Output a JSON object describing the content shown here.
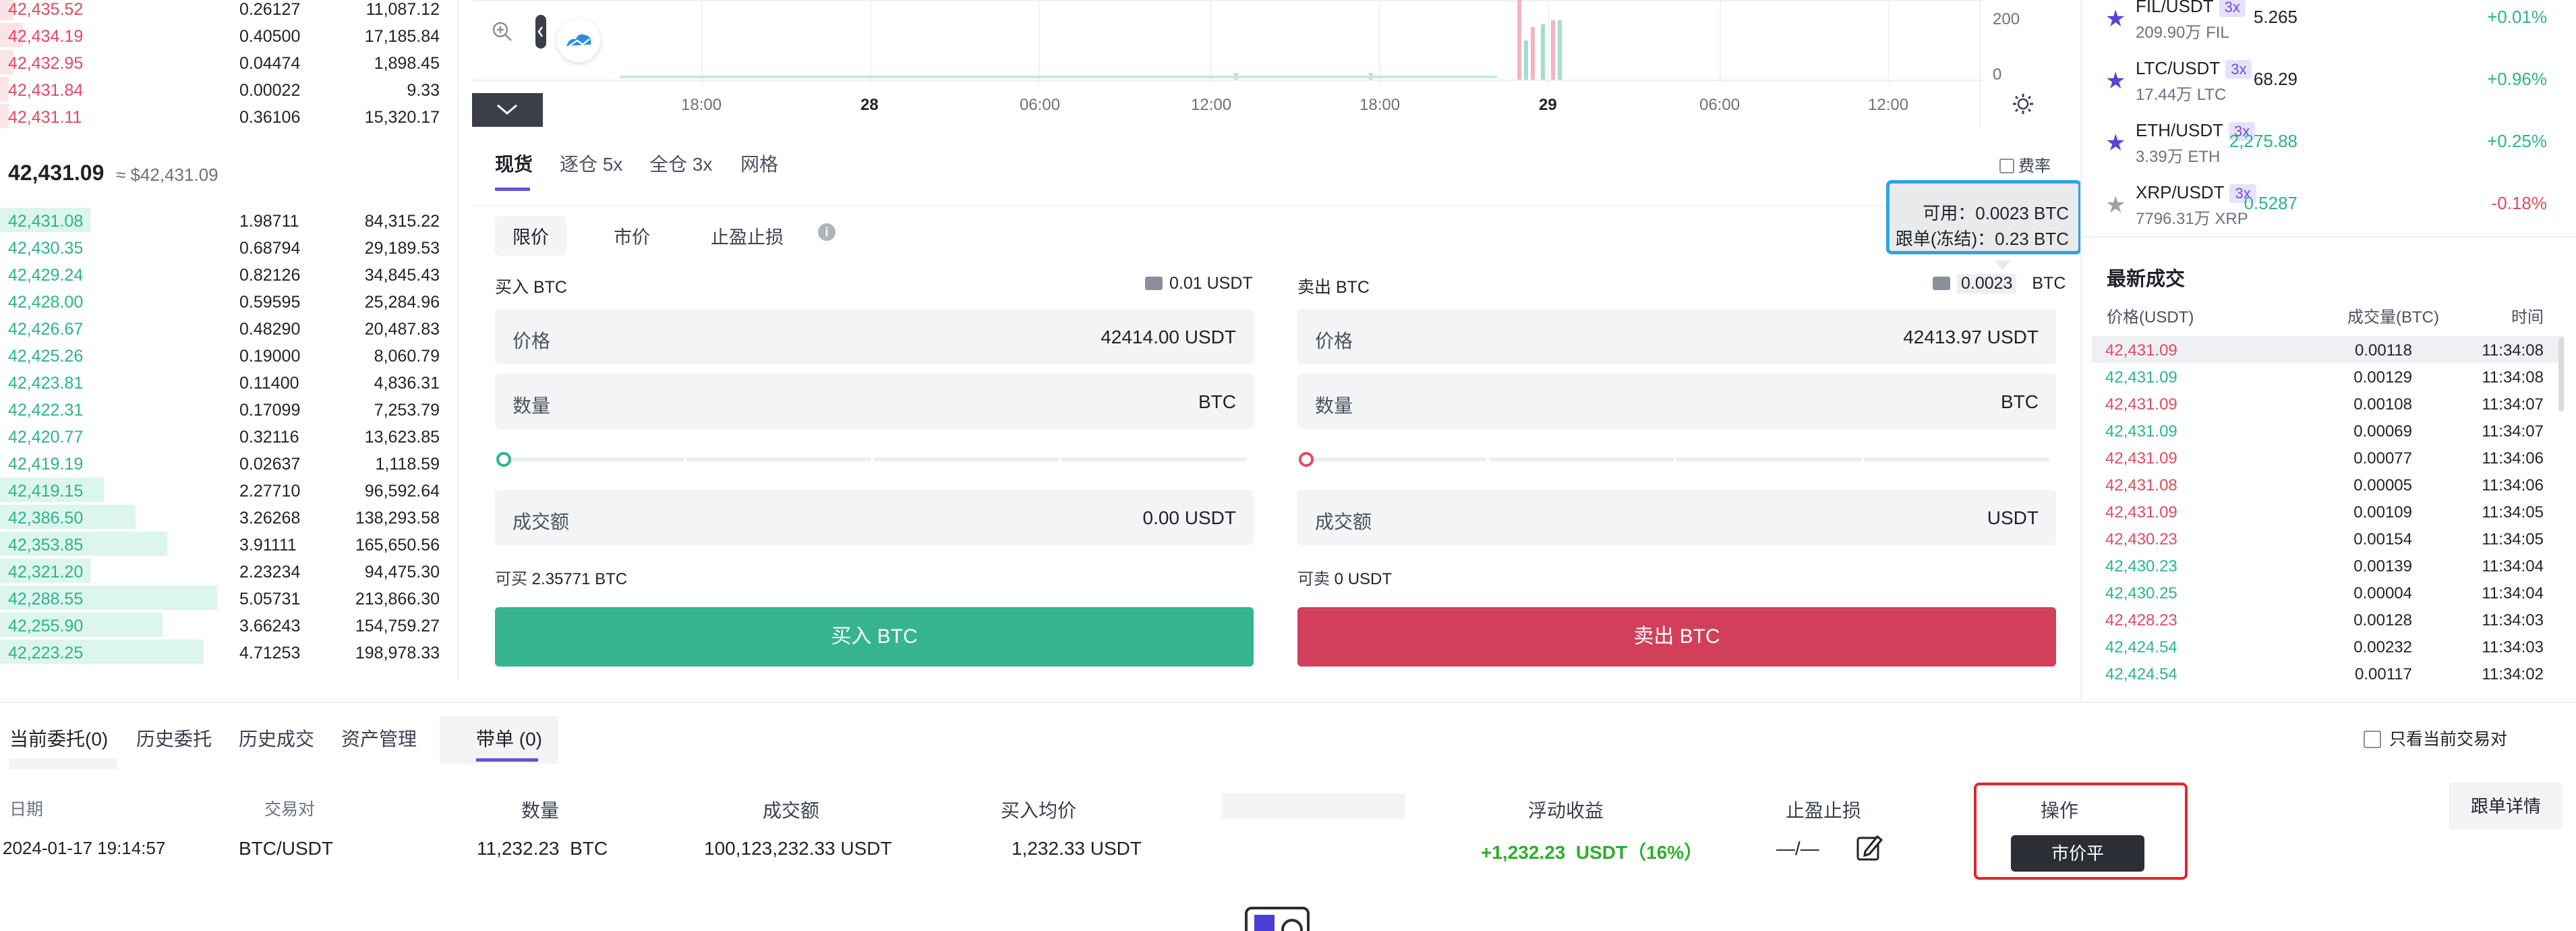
{
  "order_book": {
    "asks": [
      {
        "price": "42,435.52",
        "qty": "0.26127",
        "total": "11,087.12",
        "depth": 0.03
      },
      {
        "price": "42,434.19",
        "qty": "0.40500",
        "total": "17,185.84",
        "depth": 0.05
      },
      {
        "price": "42,432.95",
        "qty": "0.04474",
        "total": "1,898.45",
        "depth": 0.03
      },
      {
        "price": "42,431.84",
        "qty": "0.00022",
        "total": "9.33",
        "depth": 0.02
      },
      {
        "price": "42,431.11",
        "qty": "0.36106",
        "total": "15,320.17",
        "depth": 0.02
      }
    ],
    "last_price": "42,431.09",
    "last_price_ref": "≈ $42,431.09",
    "bids": [
      {
        "price": "42,431.08",
        "qty": "1.98711",
        "total": "84,315.22",
        "depth": 0.2
      },
      {
        "price": "42,430.35",
        "qty": "0.68794",
        "total": "29,189.53",
        "depth": 0.0
      },
      {
        "price": "42,429.24",
        "qty": "0.82126",
        "total": "34,845.43",
        "depth": 0.0
      },
      {
        "price": "42,428.00",
        "qty": "0.59595",
        "total": "25,284.96",
        "depth": 0.0
      },
      {
        "price": "42,426.67",
        "qty": "0.48290",
        "total": "20,487.83",
        "depth": 0.0
      },
      {
        "price": "42,425.26",
        "qty": "0.19000",
        "total": "8,060.79",
        "depth": 0.0
      },
      {
        "price": "42,423.81",
        "qty": "0.11400",
        "total": "4,836.31",
        "depth": 0.0
      },
      {
        "price": "42,422.31",
        "qty": "0.17099",
        "total": "7,253.79",
        "depth": 0.0
      },
      {
        "price": "42,420.77",
        "qty": "0.32116",
        "total": "13,623.85",
        "depth": 0.0
      },
      {
        "price": "42,419.19",
        "qty": "0.02637",
        "total": "1,118.59",
        "depth": 0.0
      },
      {
        "price": "42,419.15",
        "qty": "2.27710",
        "total": "96,592.64",
        "depth": 0.23
      },
      {
        "price": "42,386.50",
        "qty": "3.26268",
        "total": "138,293.58",
        "depth": 0.3
      },
      {
        "price": "42,353.85",
        "qty": "3.91111",
        "total": "165,650.56",
        "depth": 0.37
      },
      {
        "price": "42,321.20",
        "qty": "2.23234",
        "total": "94,475.30",
        "depth": 0.2
      },
      {
        "price": "42,288.55",
        "qty": "5.05731",
        "total": "213,866.30",
        "depth": 0.48
      },
      {
        "price": "42,255.90",
        "qty": "3.66243",
        "total": "154,759.27",
        "depth": 0.36
      },
      {
        "price": "42,223.25",
        "qty": "4.71253",
        "total": "198,978.33",
        "depth": 0.45
      }
    ]
  },
  "chart": {
    "x_ticks": [
      "18:00",
      "28",
      "06:00",
      "12:00",
      "18:00",
      "29",
      "06:00",
      "12:00"
    ],
    "y_ticks": [
      "200",
      "0"
    ],
    "icons": {
      "zoom": "zoom-icon",
      "collapse": "collapse-icon",
      "settings": "settings-icon"
    }
  },
  "trade": {
    "tabs": [
      "现货",
      "逐仓 5x",
      "全仓 3x",
      "网格"
    ],
    "fee_label": "费率",
    "order_types": [
      "限价",
      "市价",
      "止盈止损"
    ],
    "tooltip": {
      "available": "可用：0.0023 BTC",
      "frozen": "跟单(冻结)：0.23 BTC"
    },
    "buy": {
      "title": "买入 BTC",
      "balance": "0.01 USDT",
      "price_label": "价格",
      "price_value": "42414.00",
      "price_unit": "USDT",
      "qty_label": "数量",
      "qty_unit": "BTC",
      "amount_label": "成交额",
      "amount_value": "0.00",
      "amount_unit": "USDT",
      "max_label": "可买",
      "max_value": "2.35771 BTC",
      "button": "买入 BTC"
    },
    "sell": {
      "title": "卖出 BTC",
      "balance": "0.0023",
      "balance_unit": "BTC",
      "price_label": "价格",
      "price_value": "42413.97",
      "price_unit": "USDT",
      "qty_label": "数量",
      "qty_unit": "BTC",
      "amount_label": "成交额",
      "amount_unit": "USDT",
      "max_label": "可卖",
      "max_value": "0 USDT",
      "button": "卖出 BTC"
    }
  },
  "markets": [
    {
      "pair": "FIL/USDT",
      "lev": "3x",
      "vol": "209.90万 FIL",
      "price": "5.265",
      "change": "+0.01%",
      "fav": true,
      "dir": "up"
    },
    {
      "pair": "LTC/USDT",
      "lev": "3x",
      "vol": "17.44万 LTC",
      "price": "68.29",
      "change": "+0.96%",
      "fav": true,
      "dir": "up"
    },
    {
      "pair": "ETH/USDT",
      "lev": "3x",
      "vol": "3.39万 ETH",
      "price": "2,275.88",
      "change": "+0.25%",
      "fav": true,
      "dir": "up"
    },
    {
      "pair": "XRP/USDT",
      "lev": "3x",
      "vol": "7796.31万 XRP",
      "price": "0.5287",
      "change": "-0.18%",
      "fav": false,
      "dir": "down"
    }
  ],
  "recent_trades": {
    "title": "最新成交",
    "headers": [
      "价格(USDT)",
      "成交量(BTC)",
      "时间"
    ],
    "rows": [
      {
        "price": "42,431.09",
        "qty": "0.00118",
        "time": "11:34:08",
        "side": "sell"
      },
      {
        "price": "42,431.09",
        "qty": "0.00129",
        "time": "11:34:08",
        "side": "buy"
      },
      {
        "price": "42,431.09",
        "qty": "0.00108",
        "time": "11:34:07",
        "side": "sell"
      },
      {
        "price": "42,431.09",
        "qty": "0.00069",
        "time": "11:34:07",
        "side": "buy"
      },
      {
        "price": "42,431.09",
        "qty": "0.00077",
        "time": "11:34:06",
        "side": "sell"
      },
      {
        "price": "42,431.08",
        "qty": "0.00005",
        "time": "11:34:06",
        "side": "sell"
      },
      {
        "price": "42,431.09",
        "qty": "0.00109",
        "time": "11:34:05",
        "side": "sell"
      },
      {
        "price": "42,430.23",
        "qty": "0.00154",
        "time": "11:34:05",
        "side": "sell"
      },
      {
        "price": "42,430.23",
        "qty": "0.00139",
        "time": "11:34:04",
        "side": "buy"
      },
      {
        "price": "42,430.25",
        "qty": "0.00004",
        "time": "11:34:04",
        "side": "buy"
      },
      {
        "price": "42,428.23",
        "qty": "0.00128",
        "time": "11:34:03",
        "side": "sell"
      },
      {
        "price": "42,424.54",
        "qty": "0.00232",
        "time": "11:34:03",
        "side": "buy"
      },
      {
        "price": "42,424.54",
        "qty": "0.00117",
        "time": "11:34:02",
        "side": "buy"
      }
    ]
  },
  "orders": {
    "tabs": [
      "当前委托(0)",
      "历史委托",
      "历史成交",
      "资产管理",
      "带单 (0)"
    ],
    "only_current_label": "只看当前交易对",
    "headers": [
      "日期",
      "交易对",
      "数量",
      "成交额",
      "买入均价",
      "浮动收益",
      "止盈止损",
      "操作"
    ],
    "row": {
      "date": "2024-01-17 19:14:57",
      "pair": "BTC/USDT",
      "qty": "11,232.23",
      "qty_unit": "BTC",
      "amount": "100,123,232.33 USDT",
      "avg": "1,232.33 USDT",
      "pnl": "+1,232.23",
      "pnl_unit": "USDT（16%）",
      "tpsl": "—/—",
      "action": "市价平"
    },
    "detail_button": "跟单详情"
  },
  "colors": {
    "green": "#2db48a",
    "red": "#e04b5f",
    "accent_blue": "#2fa3e6",
    "annot_red": "#e0262b",
    "purple": "#6c4fd8"
  }
}
